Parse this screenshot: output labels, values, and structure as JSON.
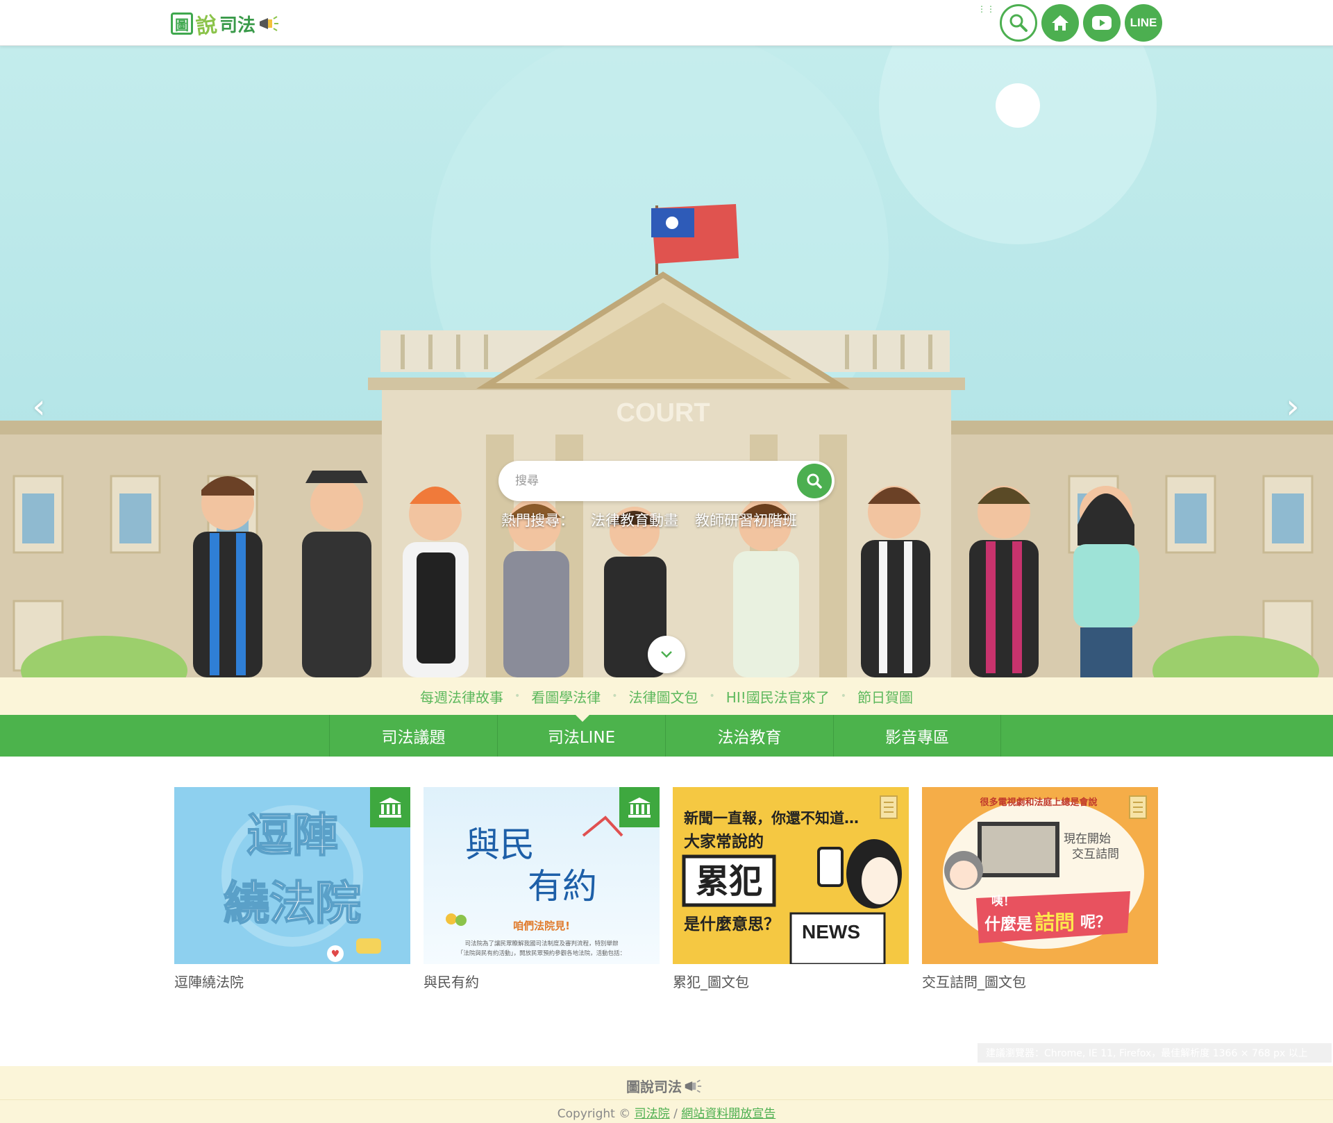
{
  "header": {
    "logo_text": "圖說司法",
    "buttons": [
      {
        "name": "search",
        "icon": "search-icon"
      },
      {
        "name": "home",
        "icon": "home-icon"
      },
      {
        "name": "youtube",
        "icon": "youtube-icon"
      },
      {
        "name": "line",
        "label": "LINE"
      }
    ]
  },
  "hero": {
    "building_sign": "COURT",
    "search": {
      "placeholder": "搜尋"
    },
    "hot_search": {
      "label": "熱門搜尋：",
      "items": [
        "法律教育動畫",
        "教師研習初階班"
      ]
    }
  },
  "subnav": {
    "items": [
      "每週法律故事",
      "看圖學法律",
      "法律圖文包",
      "HI!國民法官來了",
      "節日賀圖"
    ]
  },
  "tabs": {
    "items": [
      "司法議題",
      "司法LINE",
      "法治教育",
      "影音專區"
    ],
    "active": "司法LINE"
  },
  "cards": [
    {
      "title": "逗陣繞法院",
      "thumb_text": [
        "逗陣",
        "繞法院"
      ],
      "badge": "court-icon"
    },
    {
      "title": "與民有約",
      "thumb_text": [
        "與民",
        "有約",
        "咱們法院見!",
        "司法院為了讓民眾瞭解我國司法制度及審判流程，特別舉辦",
        "「法院與民有約活動」，開放民眾預約參觀各地法院，活動包括："
      ],
      "badge": "court-icon"
    },
    {
      "title": "累犯_圖文包",
      "thumb_text": [
        "新聞一直報，你還不知道…",
        "大家常說的",
        "累犯",
        "是什麼意思？",
        "NEWS"
      ],
      "badge": "document-icon"
    },
    {
      "title": "交互詰問_圖文包",
      "thumb_text": [
        "很多電視劇和法庭上總是會說",
        "現在開始",
        "交互詰問",
        "咦！",
        "什麼是",
        "詰問",
        "呢？"
      ],
      "badge": "document-icon"
    }
  ],
  "footer": {
    "browser_note": "建議瀏覽器：Chrome, IE 11, Firefox，最佳解析度 1366 × 768 px 以上",
    "logo_text": "圖說司法",
    "copyright": "Copyright ©",
    "link1": "司法院",
    "separator": "/",
    "link2": "網站資料開放宣告"
  },
  "colors": {
    "brand_green": "#4cb34c",
    "subbar_bg": "#fbf5d9",
    "sky": "#b6e6e8"
  }
}
